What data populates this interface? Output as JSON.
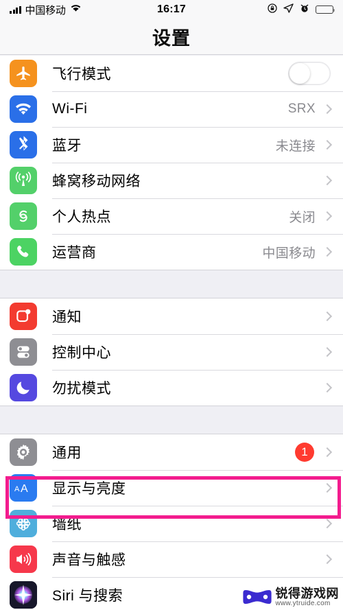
{
  "status_bar": {
    "carrier": "中国移动",
    "signal_icon": "signal-bars-icon",
    "wifi_icon": "wifi-icon",
    "time": "16:17",
    "right_icons": [
      "rotation-lock-icon",
      "location-arrow-icon",
      "alarm-clock-icon",
      "battery-icon"
    ]
  },
  "nav": {
    "title": "设置"
  },
  "sections": [
    {
      "rows": [
        {
          "label": "飞行模式",
          "icon": "airplane-icon",
          "icon_color": "#F5921E",
          "accessory": "toggle",
          "toggle_on": false
        },
        {
          "label": "Wi-Fi",
          "icon": "wifi-icon",
          "icon_color": "#2A6FE8",
          "accessory": "detail",
          "detail": "SRX"
        },
        {
          "label": "蓝牙",
          "icon": "bluetooth-icon",
          "icon_color": "#2A6FE8",
          "accessory": "detail",
          "detail": "未连接"
        },
        {
          "label": "蜂窝移动网络",
          "icon": "cellular-icon",
          "icon_color": "#53D06A",
          "accessory": "chevron",
          "detail": ""
        },
        {
          "label": "个人热点",
          "icon": "hotspot-icon",
          "icon_color": "#53D06A",
          "accessory": "detail",
          "detail": "关闭"
        },
        {
          "label": "运营商",
          "icon": "phone-icon",
          "icon_color": "#4CD363",
          "accessory": "detail",
          "detail": "中国移动"
        }
      ]
    },
    {
      "rows": [
        {
          "label": "通知",
          "icon": "notifications-icon",
          "icon_color": "#F33B30",
          "accessory": "chevron",
          "detail": ""
        },
        {
          "label": "控制中心",
          "icon": "control-center-icon",
          "icon_color": "#8E8E93",
          "accessory": "chevron",
          "detail": ""
        },
        {
          "label": "勿扰模式",
          "icon": "do-not-disturb-icon",
          "icon_color": "#5549E0",
          "accessory": "chevron",
          "detail": ""
        }
      ]
    },
    {
      "rows": [
        {
          "label": "通用",
          "icon": "gear-icon",
          "icon_color": "#8E8E93",
          "accessory": "badge",
          "badge": "1"
        },
        {
          "label": "显示与亮度",
          "icon": "display-brightness-icon",
          "icon_color": "#2A7BF0",
          "accessory": "chevron",
          "detail": "",
          "highlighted": true
        },
        {
          "label": "墙纸",
          "icon": "wallpaper-icon",
          "icon_color": "#4FAEDC",
          "accessory": "chevron",
          "detail": ""
        },
        {
          "label": "声音与触感",
          "icon": "sounds-haptics-icon",
          "icon_color": "#F6384B",
          "accessory": "chevron",
          "detail": ""
        },
        {
          "label": "Siri 与搜索",
          "icon": "siri-icon",
          "icon_color": "#1B1B2B",
          "accessory": "chevron",
          "detail": ""
        }
      ]
    }
  ],
  "highlight": {
    "color": "#F31C8E"
  },
  "watermark": {
    "title": "锐得游戏网",
    "url": "www.ytruide.com",
    "logo_color": "#3B2BD0"
  }
}
